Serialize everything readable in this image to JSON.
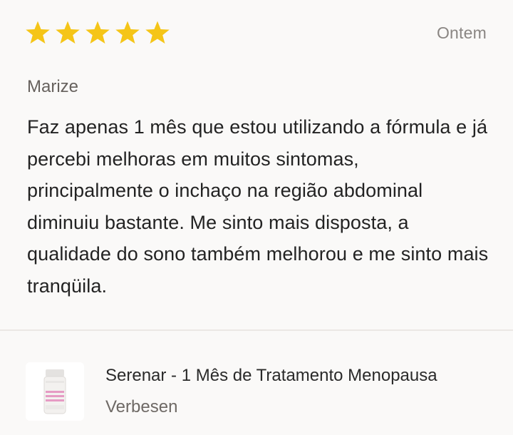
{
  "review": {
    "rating": 5,
    "rating_max": 5,
    "date": "Ontem",
    "author": "Marize",
    "body": "Faz apenas 1 mês que estou utilizando a fórmula e já percebi melhoras em muitos sintomas, principalmente o inchaço na região abdominal diminuiu bastante. Me sinto mais disposta, a qualidade do sono também melhorou e me sinto mais tranqüila."
  },
  "product": {
    "title": "Serenar - 1 Mês de Tratamento Menopausa",
    "brand": "Verbesen",
    "image_icon": "supplement-bottle-icon"
  },
  "colors": {
    "star": "#f5c518",
    "background": "#faf9f8",
    "accent_pink": "#e69bc4"
  }
}
